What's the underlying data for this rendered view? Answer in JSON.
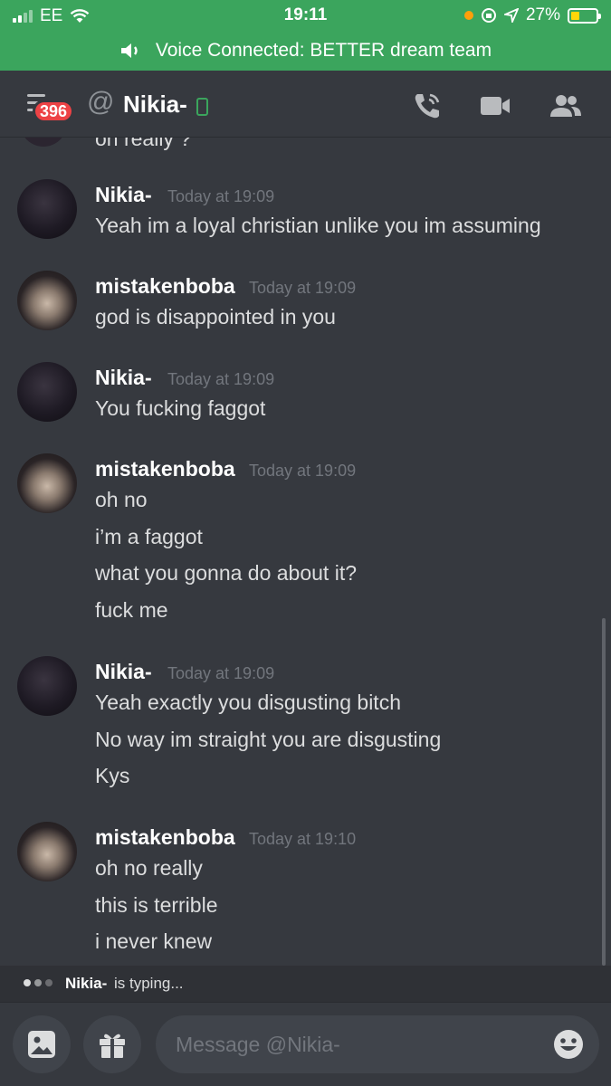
{
  "status_bar": {
    "carrier": "EE",
    "time": "19:11",
    "battery": "27%"
  },
  "voice_banner": {
    "text": "Voice Connected: BETTER dream team"
  },
  "header": {
    "unread_badge": "396",
    "at_symbol": "@",
    "title": "Nikia-"
  },
  "messages": {
    "cut_off_line": "oh really ?",
    "groups": [
      {
        "author": "Nikia-",
        "timestamp": "Today at 19:09",
        "lines": [
          "Yeah im a loyal christian unlike you im assuming"
        ]
      },
      {
        "author": "mistakenboba",
        "timestamp": "Today at 19:09",
        "lines": [
          "god is disappointed in you"
        ]
      },
      {
        "author": "Nikia-",
        "timestamp": "Today at 19:09",
        "lines": [
          "You fucking faggot"
        ]
      },
      {
        "author": "mistakenboba",
        "timestamp": "Today at 19:09",
        "lines": [
          "oh no",
          "i’m a faggot",
          "what you gonna do about it?",
          "fuck me"
        ]
      },
      {
        "author": "Nikia-",
        "timestamp": "Today at 19:09",
        "lines": [
          "Yeah exactly you disgusting bitch",
          "No way im straight you are disgusting",
          "Kys"
        ]
      },
      {
        "author": "mistakenboba",
        "timestamp": "Today at 19:10",
        "lines": [
          "oh no really",
          "this is terrible",
          "i never knew"
        ]
      }
    ]
  },
  "typing": {
    "user": "Nikia-",
    "text": "is typing..."
  },
  "composer": {
    "placeholder": "Message @Nikia-"
  },
  "colors": {
    "voice_green": "#3ba55d",
    "background": "#36393f",
    "badge_red": "#ed4245"
  },
  "icons": [
    "signal-icon",
    "wifi-icon",
    "location-icon",
    "battery-icon",
    "speaker-icon",
    "menu-icon",
    "mobile-status-icon",
    "call-icon",
    "video-icon",
    "members-icon",
    "image-icon",
    "gift-icon",
    "emoji-icon"
  ]
}
